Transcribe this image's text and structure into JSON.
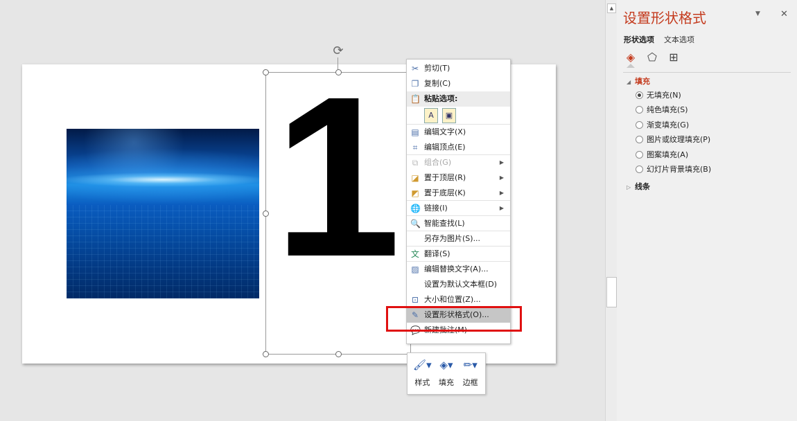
{
  "slide": {
    "big_number": "1"
  },
  "context_menu": {
    "items": [
      {
        "label": "剪切(T)",
        "icon": "scissors-icon"
      },
      {
        "label": "复制(C)",
        "icon": "copy-icon"
      },
      {
        "label": "粘贴选项:",
        "icon": "paste-icon"
      },
      {
        "label": "编辑文字(X)",
        "icon": "edit-text-icon"
      },
      {
        "label": "编辑顶点(E)",
        "icon": "edit-points-icon"
      },
      {
        "label": "组合(G)",
        "icon": "group-icon"
      },
      {
        "label": "置于顶层(R)",
        "icon": "bring-to-front-icon"
      },
      {
        "label": "置于底层(K)",
        "icon": "send-to-back-icon"
      },
      {
        "label": "链接(I)",
        "icon": "link-icon"
      },
      {
        "label": "智能查找(L)",
        "icon": "smart-lookup-icon"
      },
      {
        "label": "另存为图片(S)...",
        "icon": ""
      },
      {
        "label": "翻译(S)",
        "icon": "translate-icon"
      },
      {
        "label": "编辑替换文字(A)...",
        "icon": "alt-text-icon"
      },
      {
        "label": "设置为默认文本框(D)",
        "icon": ""
      },
      {
        "label": "大小和位置(Z)...",
        "icon": "size-position-icon"
      },
      {
        "label": "设置形状格式(O)...",
        "icon": "format-shape-icon"
      },
      {
        "label": "新建批注(M)",
        "icon": "new-comment-icon"
      }
    ]
  },
  "mini_toolbar": {
    "style": "样式",
    "fill": "填充",
    "outline": "边框"
  },
  "pane": {
    "title": "设置形状格式",
    "tab_shape": "形状选项",
    "tab_text": "文本选项",
    "fill_section": "填充",
    "line_section": "线条",
    "fill_options": [
      "无填充(N)",
      "纯色填充(S)",
      "渐变填充(G)",
      "图片或纹理填充(P)",
      "图案填充(A)",
      "幻灯片背景填充(B)"
    ],
    "selected_fill": "无填充(N)",
    "accent_color": "#c43b1e"
  }
}
